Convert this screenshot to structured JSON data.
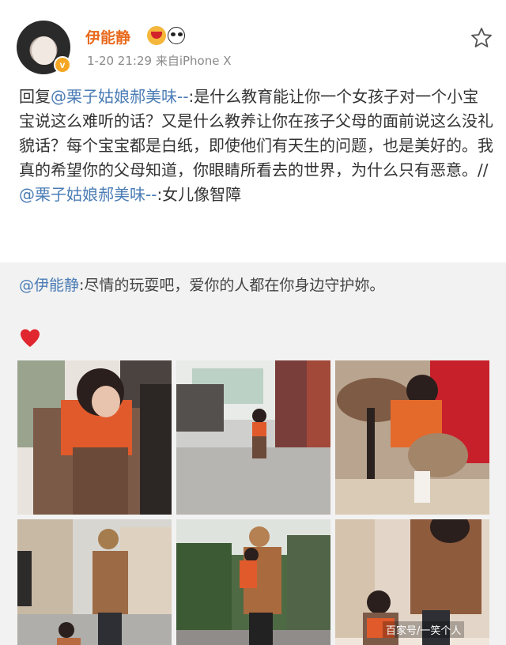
{
  "post": {
    "username": "伊能静",
    "timestamp": "1-20 21:29",
    "source": "来自iPhone X",
    "text_prefix": "回复",
    "mention_1": "@栗子姑娘郝美味--",
    "body_1": ":是什么教育能让你一个女孩子对一个小宝宝说这么难听的话？又是什么教养让你在孩子父母的面前说这么没礼貌话？每个宝宝都是白纸，即使他们有天生的问题，也是美好的。我真的希望你的父母知道，你眼睛所看去的世界，为什么只有恶意。//",
    "mention_2": "@栗子姑娘郝美味--",
    "body_2": ":女儿像智障"
  },
  "repost": {
    "mention": "@伊能静",
    "text": ":尽情的玩耍吧，爱你的人都在你身边守护妳。"
  },
  "icons": {
    "verified": "v",
    "star": "star-icon",
    "heart": "heart-icon"
  },
  "colors": {
    "username": "#e86b1f",
    "mention": "#4a7cb5",
    "repost_bg": "#f2f2f2"
  },
  "watermark": "百家号/一笑个人"
}
